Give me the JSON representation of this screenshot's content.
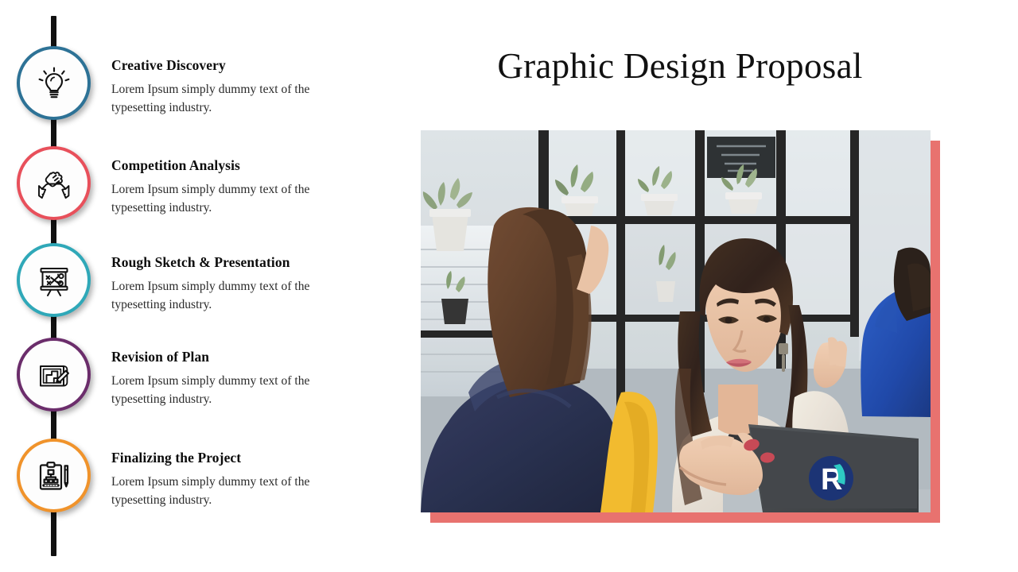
{
  "slide": {
    "title": "Graphic Design Proposal",
    "background_color": "#ffffff",
    "accent_frame_color": "#e8726f",
    "timeline_line_color": "#111111"
  },
  "timeline": {
    "steps": [
      {
        "title": "Creative Discovery",
        "description": "Lorem Ipsum simply dummy text of the typesetting industry.",
        "icon": "lightbulb-icon",
        "ring_color": "#2d7296"
      },
      {
        "title": "Competition Analysis",
        "description": "Lorem Ipsum simply dummy text of the typesetting industry.",
        "icon": "handshake-icon",
        "ring_color": "#e8505b"
      },
      {
        "title": "Rough Sketch & Presentation",
        "description": "Lorem Ipsum simply dummy text of the typesetting industry.",
        "icon": "strategy-board-icon",
        "ring_color": "#2fa8b8"
      },
      {
        "title": "Revision of Plan",
        "description": "Lorem Ipsum simply dummy text of the typesetting industry.",
        "icon": "blueprint-pencil-icon",
        "ring_color": "#6b2d6b"
      },
      {
        "title": "Finalizing the Project",
        "description": "Lorem Ipsum simply dummy text of the typesetting industry.",
        "icon": "clipboard-pencil-icon",
        "ring_color": "#f0932b"
      }
    ]
  },
  "photo": {
    "alt": "Three women in a business meeting at an office table with a laptop",
    "laptop_sticker_letter": "R"
  }
}
